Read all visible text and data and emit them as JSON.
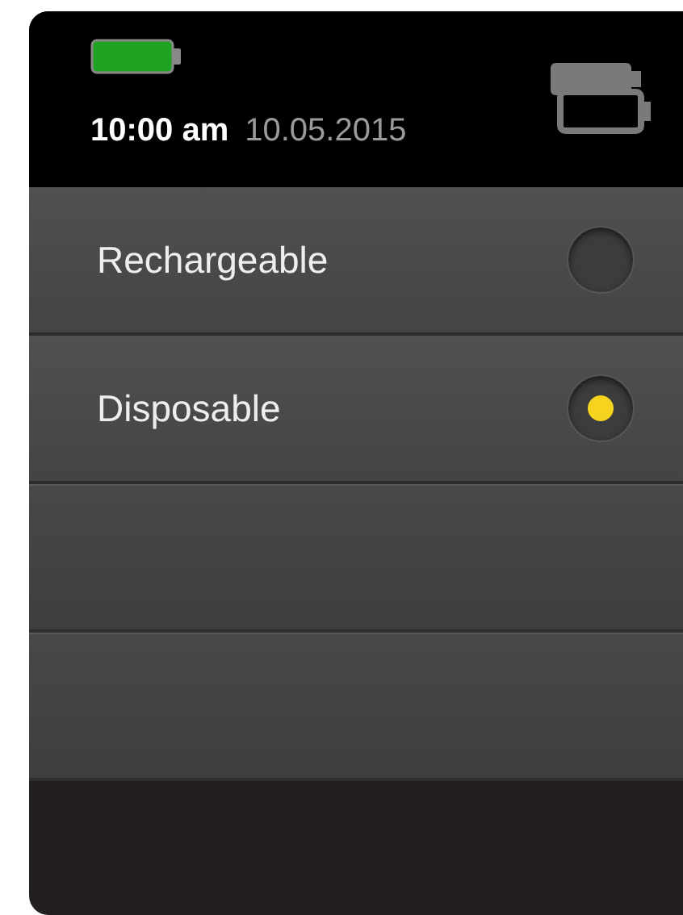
{
  "status_bar": {
    "time": "10:00 am",
    "date": "10.05.2015"
  },
  "options": [
    {
      "label": "Rechargeable",
      "selected": false
    },
    {
      "label": "Disposable",
      "selected": true
    }
  ]
}
